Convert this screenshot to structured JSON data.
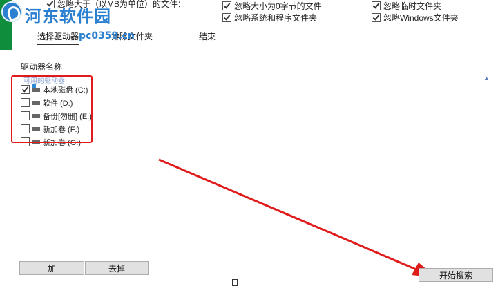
{
  "watermark": {
    "title": "河东软件园",
    "url": "pc0359.cn"
  },
  "options": {
    "ignore_larger": "忽略大于（以MB为单位）的文件：",
    "ignore_zero": "忽略大小为0字节的文件",
    "ignore_system": "忽略系统和程序文件夹",
    "ignore_temp": "忽略临时文件夹",
    "ignore_windows": "忽略Windows文件夹"
  },
  "tabs": [
    {
      "label": "选择驱动器",
      "active": true
    },
    {
      "label": "排除文件夹",
      "active": false
    },
    {
      "label": "结束",
      "active": false
    }
  ],
  "drives_header": "驱动器名称",
  "drives_group": "可用的驱动器",
  "drives": [
    {
      "label": "本地磁盘 (C:)",
      "checked": true,
      "icon": "system-drive-icon"
    },
    {
      "label": "软件 (D:)",
      "checked": false,
      "icon": "drive-icon"
    },
    {
      "label": "备份[勿删] (E:)",
      "checked": false,
      "icon": "drive-icon"
    },
    {
      "label": "新加卷 (F:)",
      "checked": false,
      "icon": "drive-icon"
    },
    {
      "label": "新加卷 (G:)",
      "checked": false,
      "icon": "drive-icon"
    }
  ],
  "buttons": {
    "add": "加",
    "remove": "去掉",
    "start": "开始搜索"
  },
  "colors": {
    "annotation_red": "#e01b1b",
    "brand_green": "#0f8c3c",
    "watermark_blue": "#2a7fd0"
  }
}
